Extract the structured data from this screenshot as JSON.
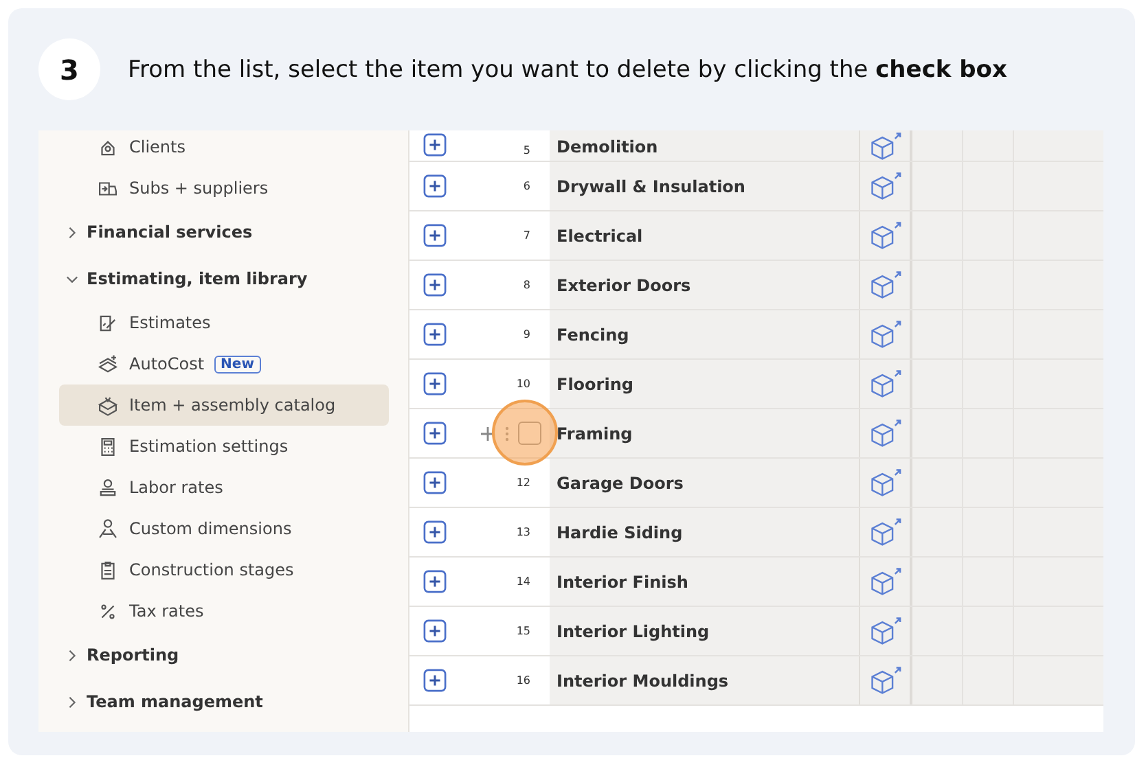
{
  "step": {
    "number": "3",
    "instruction": "From the list, select the item you want to delete by clicking the **check box**"
  },
  "sidebar": {
    "items": [
      {
        "kind": "link",
        "label": "Clients",
        "selected": false
      },
      {
        "kind": "link",
        "label": "Subs + suppliers",
        "selected": false
      },
      {
        "kind": "section",
        "label": "Financial services",
        "expanded": false
      },
      {
        "kind": "section",
        "label": "Estimating, item library",
        "expanded": true,
        "children": [
          {
            "kind": "link",
            "label": "Estimates",
            "selected": false
          },
          {
            "kind": "link",
            "label": "AutoCost",
            "badge": "New",
            "selected": false
          },
          {
            "kind": "link",
            "label": "Item + assembly catalog",
            "selected": true
          },
          {
            "kind": "link",
            "label": "Estimation settings",
            "selected": false
          },
          {
            "kind": "link",
            "label": "Labor rates",
            "selected": false
          },
          {
            "kind": "link",
            "label": "Custom dimensions",
            "selected": false
          },
          {
            "kind": "link",
            "label": "Construction stages",
            "selected": false
          },
          {
            "kind": "link",
            "label": "Tax rates",
            "selected": false
          }
        ]
      },
      {
        "kind": "section",
        "label": "Reporting",
        "expanded": false
      },
      {
        "kind": "section",
        "label": "Team management",
        "expanded": false
      }
    ]
  },
  "table": {
    "rows": [
      {
        "kind": "plain",
        "number": "5",
        "name": "Demolition"
      },
      {
        "kind": "plain",
        "number": "6",
        "name": "Drywall & Insulation"
      },
      {
        "kind": "plain",
        "number": "7",
        "name": "Electrical"
      },
      {
        "kind": "plain",
        "number": "8",
        "name": "Exterior Doors"
      },
      {
        "kind": "plain",
        "number": "9",
        "name": "Fencing"
      },
      {
        "kind": "plain",
        "number": "10",
        "name": "Flooring"
      },
      {
        "kind": "hover",
        "checked": false,
        "name": "Framing"
      },
      {
        "kind": "plain",
        "number": "12",
        "name": "Garage Doors"
      },
      {
        "kind": "plain",
        "number": "13",
        "name": "Hardie Siding"
      },
      {
        "kind": "plain",
        "number": "14",
        "name": "Interior Finish"
      },
      {
        "kind": "plain",
        "number": "15",
        "name": "Interior Lighting"
      },
      {
        "kind": "plain",
        "number": "16",
        "name": "Interior Mouldings"
      }
    ]
  }
}
